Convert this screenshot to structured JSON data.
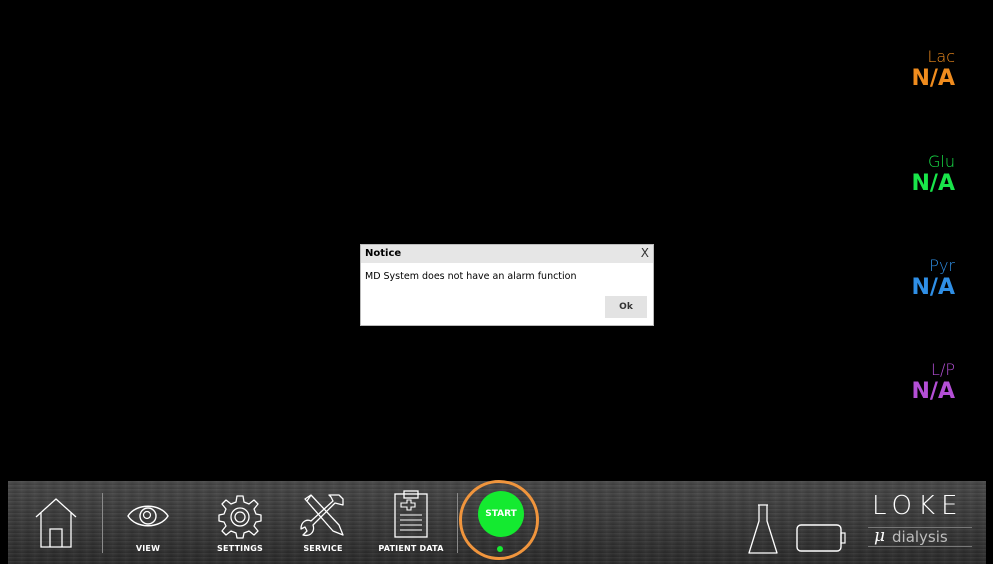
{
  "metrics": [
    {
      "label": "Lac",
      "value": "N/A",
      "color": "#f08c1e"
    },
    {
      "label": "Glu",
      "value": "N/A",
      "color": "#19e64a"
    },
    {
      "label": "Pyr",
      "value": "N/A",
      "color": "#2f8fe6"
    },
    {
      "label": "L/P",
      "value": "N/A",
      "color": "#b44fd6"
    }
  ],
  "dialog": {
    "title": "Notice",
    "close": "X",
    "message": "MD System does not have an alarm function",
    "ok_label": "Ok"
  },
  "toolbar": {
    "home_icon": "home-icon",
    "view_label": "VIEW",
    "settings_label": "SETTINGS",
    "service_label": "SERVICE",
    "patient_data_label": "PATIENT DATA",
    "start_label": "START",
    "start_color": "#14ea30",
    "start_ring_color": "#f0953d",
    "vial_icon": "vial-icon",
    "battery_icon": "battery-icon"
  },
  "logo": {
    "brand": "LOKE",
    "mu": "μ",
    "sub": "dialysis"
  }
}
